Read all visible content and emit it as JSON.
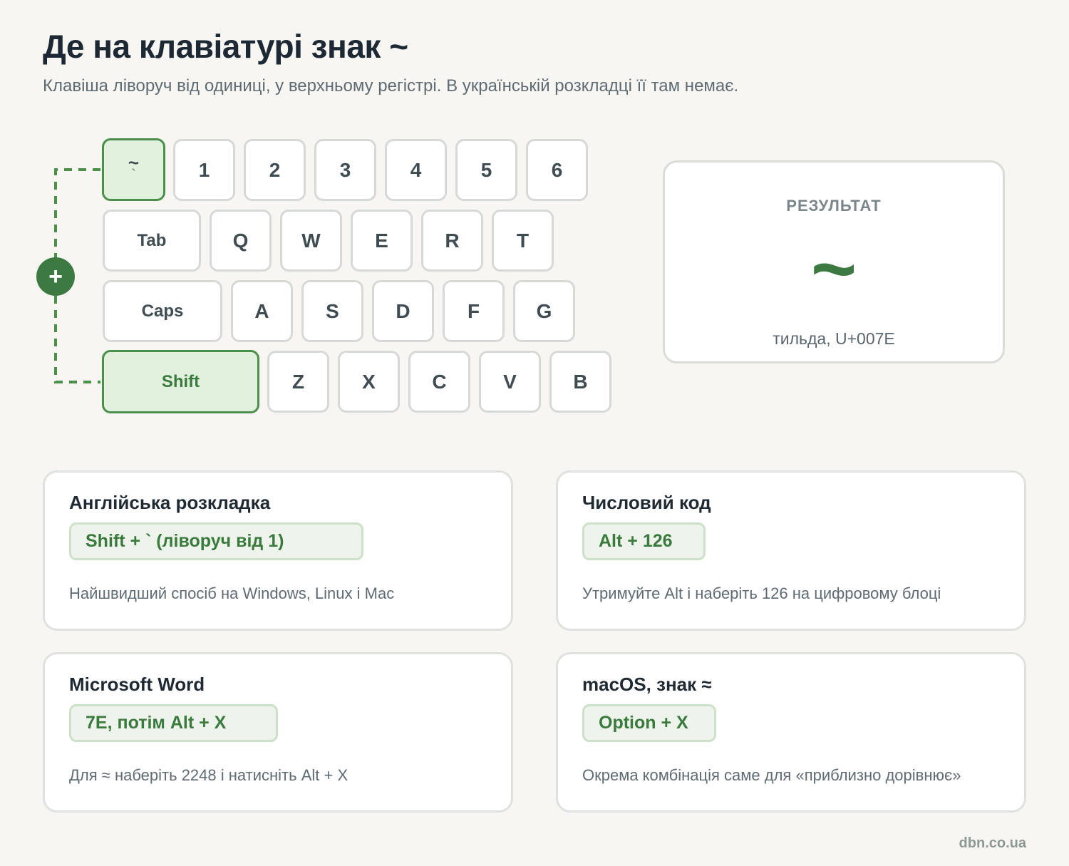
{
  "header": {
    "title": "Де на клавіатурі знак ~",
    "subtitle": "Клавіша ліворуч від одиниці, у верхньому регістрі. В українській розкладці її там немає."
  },
  "keyboard": {
    "tilde_key": {
      "upper": "~",
      "lower": "`"
    },
    "row1": [
      "1",
      "2",
      "3",
      "4",
      "5",
      "6"
    ],
    "row2": [
      "Tab",
      "Q",
      "W",
      "E",
      "R",
      "T"
    ],
    "row3": [
      "Caps",
      "A",
      "S",
      "D",
      "F",
      "G"
    ],
    "row4": [
      "Shift",
      "Z",
      "X",
      "C",
      "V",
      "B"
    ],
    "plus": "+",
    "highlight_color": "#4a8f4a"
  },
  "result": {
    "label": "РЕЗУЛЬТАТ",
    "symbol": "~",
    "description": "тильда, U+007E"
  },
  "cards": [
    {
      "title": "Англійська розкладка",
      "combo": "Shift + ` (ліворуч від 1)",
      "description": "Найшвидший спосіб на Windows, Linux і Mac"
    },
    {
      "title": "Числовий код",
      "combo": "Alt + 126",
      "description": "Утримуйте Alt і наберіть 126 на цифровому блоці"
    },
    {
      "title": "Microsoft Word",
      "combo": "7E, потім Alt + X",
      "description": "Для ≈ наберіть 2248 і натисніть Alt + X"
    },
    {
      "title": "macOS, знак ≈",
      "combo": "Option + X",
      "description": "Окрема комбінація саме для «приблизно дорівнює»"
    }
  ],
  "footer": {
    "site": "dbn.co.ua"
  },
  "colors": {
    "accent": "#3d7a42",
    "background": "#f7f6f2"
  }
}
